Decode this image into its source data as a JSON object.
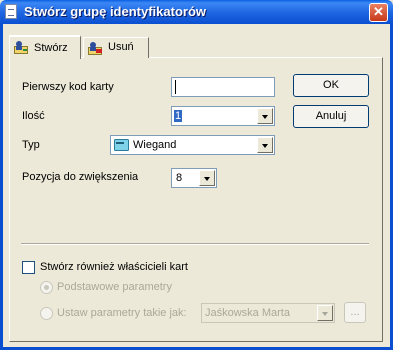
{
  "window": {
    "title": "Stwórz grupę identyfikatorów",
    "close_label": "✕"
  },
  "tabs": [
    {
      "label": "Stwórz"
    },
    {
      "label": "Usuń"
    }
  ],
  "form": {
    "first_card_code": {
      "label": "Pierwszy kod karty",
      "value": ""
    },
    "quantity": {
      "label": "Ilość",
      "value": "1"
    },
    "type": {
      "label": "Typ",
      "value": "Wiegand"
    },
    "increment_position": {
      "label": "Pozycja do zwiększenia",
      "value": "8"
    }
  },
  "buttons": {
    "ok": "OK",
    "cancel": "Anuluj",
    "ellipsis": "..."
  },
  "owners": {
    "checkbox_label": "Stwórz również właścicieli kart",
    "basic_params_label": "Podstawowe parametry",
    "set_params_label": "Ustaw parametry takie jak:",
    "set_params_value": "Jaśkowska Marta"
  },
  "colors": {
    "titlebar": "#0B4FD1",
    "dialog_bg": "#ECE9D8",
    "selection": "#316AC5",
    "close": "#C8391B"
  }
}
